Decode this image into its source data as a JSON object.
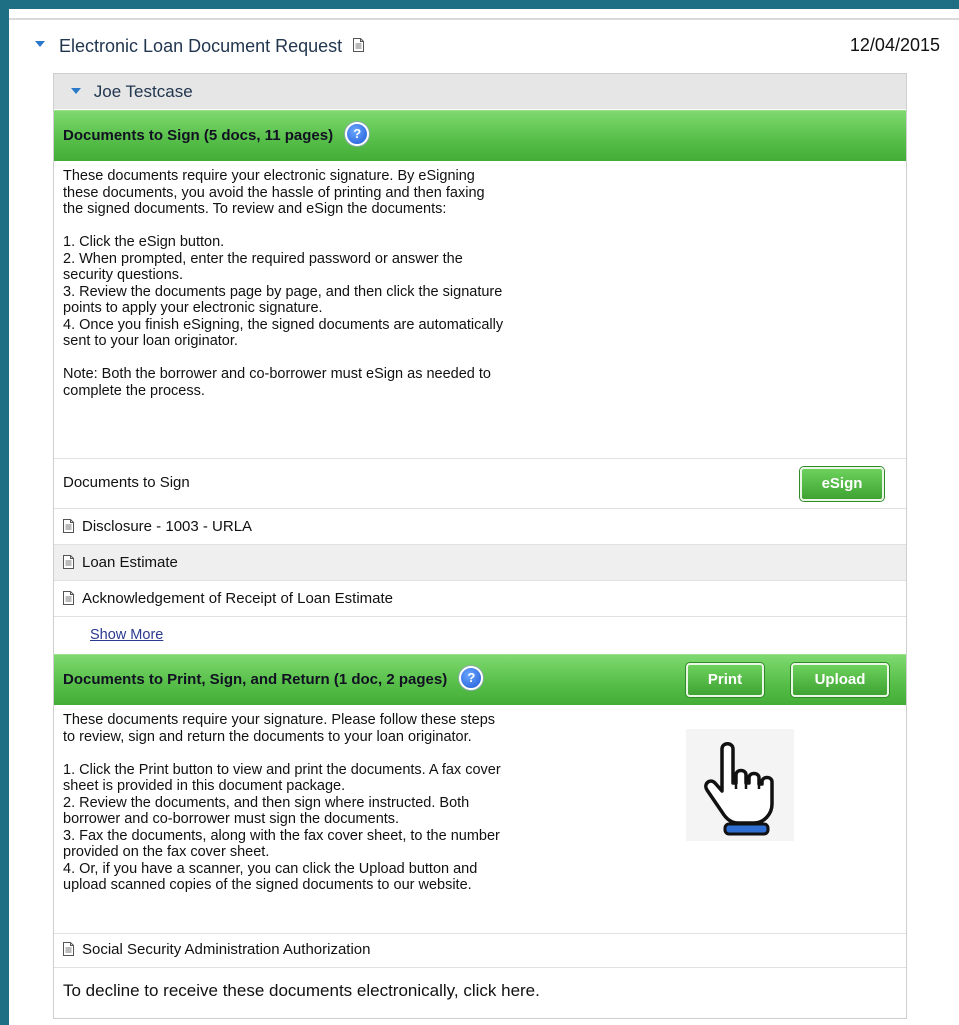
{
  "header": {
    "title": "Electronic Loan Document Request",
    "date": "12/04/2015"
  },
  "borrower": {
    "name": "Joe Testcase"
  },
  "sign_section": {
    "title": "Documents to Sign (5 docs, 11 pages)",
    "help": "?",
    "instructions": "These documents require your electronic signature. By eSigning\nthese documents, you avoid the hassle of printing and then faxing\nthe signed documents. To review and eSign the documents:\n\n1. Click the eSign button.\n2. When prompted, enter the required password or answer the\nsecurity questions.\n3. Review the documents page by page, and then click the signature\npoints to apply your electronic signature.\n4. Once you finish eSigning, the signed documents are automatically\nsent to your loan originator.\n\nNote: Both the borrower and co-borrower must eSign as needed to\ncomplete the process.",
    "list_label": "Documents to Sign",
    "esign_label": "eSign",
    "documents": [
      "Disclosure - 1003 - URLA",
      "Loan Estimate",
      "Acknowledgement of Receipt of Loan Estimate"
    ],
    "show_more": "Show More"
  },
  "print_section": {
    "title": "Documents to Print, Sign, and Return (1 doc, 2 pages)",
    "help": "?",
    "print_label": "Print",
    "upload_label": "Upload",
    "instructions": "These documents require your signature. Please follow these steps\nto review, sign and return the documents to your loan originator.\n\n1. Click the Print button to view and print the documents. A fax cover\nsheet is provided in this document package.\n2. Review the documents, and then sign where instructed. Both\nborrower and co-borrower must sign the documents.\n3. Fax the documents, along with the fax cover sheet, to the number\nprovided on the fax cover sheet.\n4. Or, if you have a scanner, you can click the Upload button and\nupload scanned copies of the signed documents to our website.",
    "documents": [
      "Social Security Administration Authorization"
    ]
  },
  "decline_text": "To decline to receive these documents electronically, click here.",
  "icons": {
    "expand": "caret-down-icon",
    "document": "document-icon",
    "help": "help-icon",
    "cursor": "hand-pointer-cursor-icon"
  },
  "colors": {
    "frame": "#1e6e84",
    "green_bar": "#58c04a",
    "caret": "#2a78c9",
    "link": "#2b3a8f"
  }
}
